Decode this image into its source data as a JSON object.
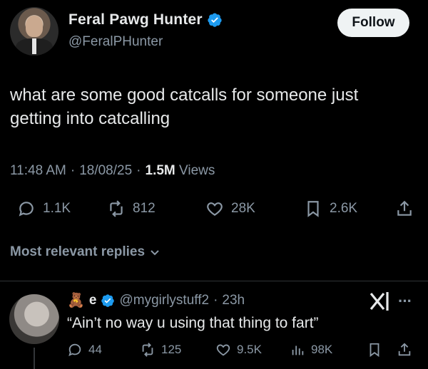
{
  "tweet": {
    "author": {
      "display_name": "Feral Pawg Hunter",
      "handle": "@FeralPHunter",
      "verified": true,
      "avatar": "man-in-suit-avatar"
    },
    "follow_label": "Follow",
    "text": "what are some good catcalls for someone just getting into catcalling",
    "time": "11:48 AM",
    "sep1": "·",
    "date": "18/08/25",
    "sep2": "·",
    "views_count": "1.5M",
    "views_label": "Views",
    "stats": {
      "replies": "1.1K",
      "reposts": "812",
      "likes": "28K",
      "bookmarks": "2.6K"
    }
  },
  "replies_section": {
    "label": "Most relevant replies"
  },
  "reply": {
    "emoji": "🧸",
    "display_name": "e",
    "handle": "@mygirlystuff2",
    "sep": "·",
    "age": "23h",
    "text": "“Ain’t no way u using that thing to fart”",
    "stats": {
      "replies": "44",
      "reposts": "125",
      "likes": "9.5K",
      "views": "98K"
    }
  },
  "colors": {
    "background": "#000000",
    "text": "#e7e9ea",
    "muted": "#8b98a5",
    "verified": "#1d9bf0",
    "divider": "#2f3336"
  }
}
